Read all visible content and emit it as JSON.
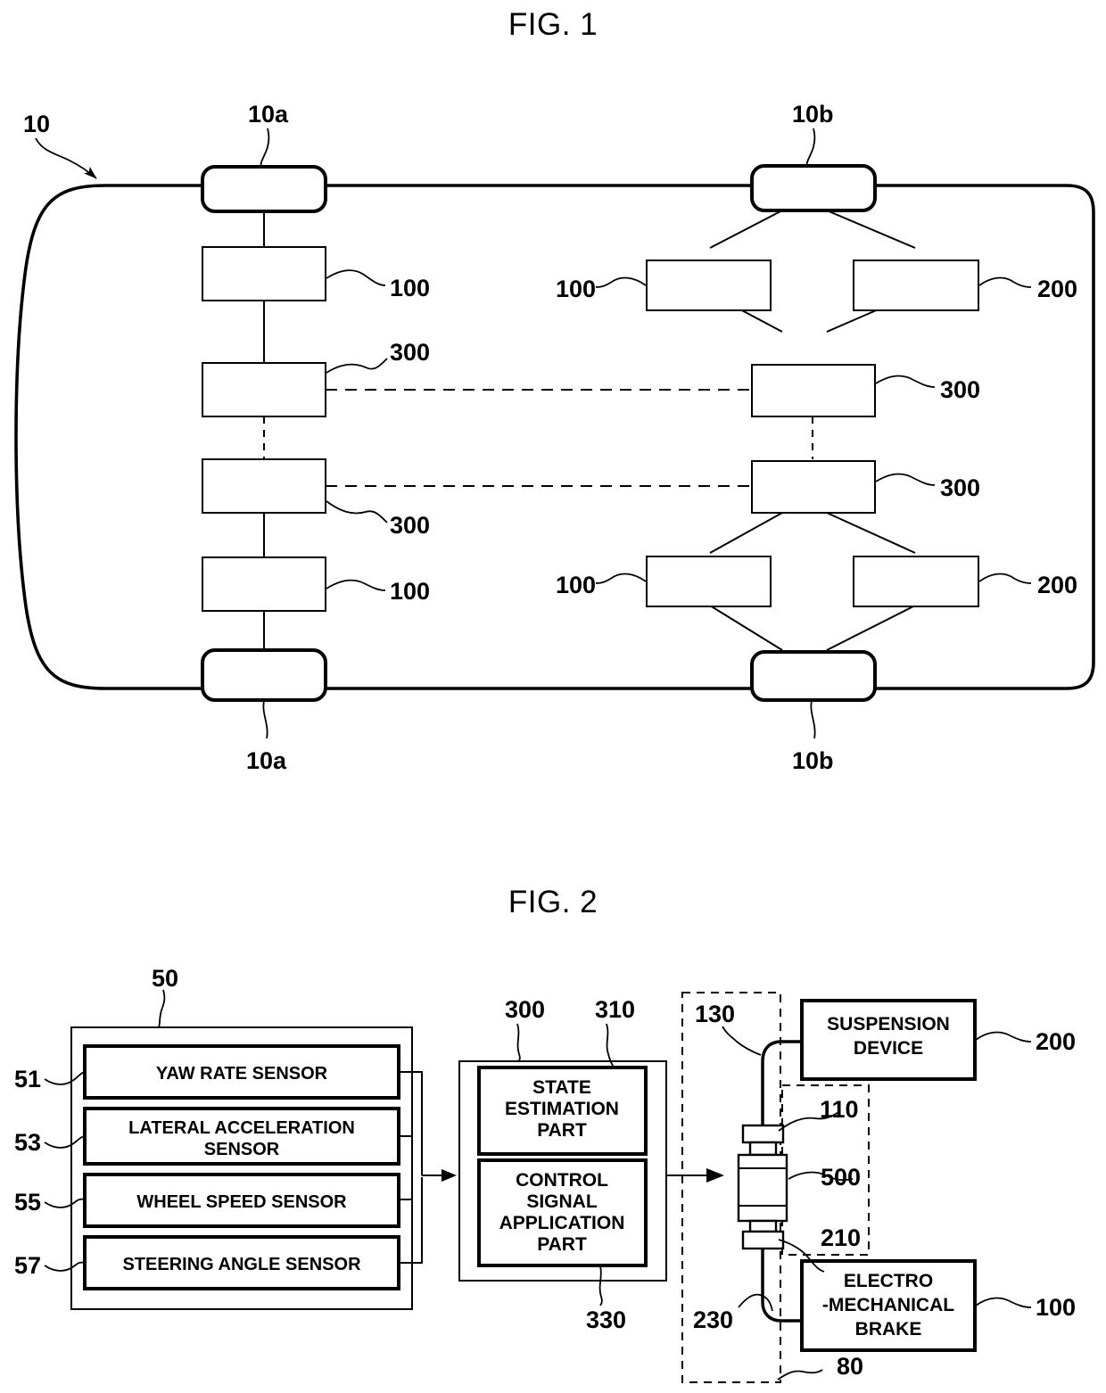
{
  "figures": [
    {
      "id": "fig1",
      "title": "FIG. 1",
      "refs": {
        "vehicle": "10",
        "front_wheel_top": "10a",
        "front_wheel_bottom": "10a",
        "rear_wheel_top": "10b",
        "rear_wheel_bottom": "10b",
        "brake_fl": "100",
        "controller_fl": "300",
        "controller_rl": "300",
        "brake_rl": "100",
        "brake_fr": "100",
        "suspension_fr": "200",
        "controller_fr": "300",
        "controller_rr": "300",
        "brake_rr": "100",
        "suspension_rr": "200"
      }
    },
    {
      "id": "fig2",
      "title": "FIG. 2",
      "sensor_group": {
        "ref": "50",
        "items": [
          {
            "ref": "51",
            "label": "YAW RATE SENSOR"
          },
          {
            "ref": "53",
            "label": "LATERAL ACCELERATION\nSENSOR",
            "line1": "LATERAL ACCELERATION",
            "line2": "SENSOR"
          },
          {
            "ref": "55",
            "label": "WHEEL SPEED SENSOR"
          },
          {
            "ref": "57",
            "label": "STEERING ANGLE SENSOR"
          }
        ]
      },
      "controller": {
        "ref": "300",
        "parts": [
          {
            "ref": "310",
            "line1": "STATE",
            "line2": "ESTIMATION",
            "line3": "PART"
          },
          {
            "ref": "330",
            "line1": "CONTROL",
            "line2": "SIGNAL",
            "line3": "APPLICATION",
            "line4": "PART"
          }
        ]
      },
      "actuators": {
        "suspension": {
          "ref": "200",
          "line1": "SUSPENSION",
          "line2": "DEVICE"
        },
        "brake": {
          "ref": "100",
          "line1": "ELECTRO",
          "line2": "-MECHANICAL",
          "line3": "BRAKE"
        },
        "connector_top": "110",
        "connector_body": "500",
        "connector_bottom": "210",
        "harness_top": "130",
        "harness_bottom": "230",
        "assembly": "80"
      }
    }
  ],
  "colors": {
    "line": "#000000",
    "fill": "#ffffff"
  }
}
